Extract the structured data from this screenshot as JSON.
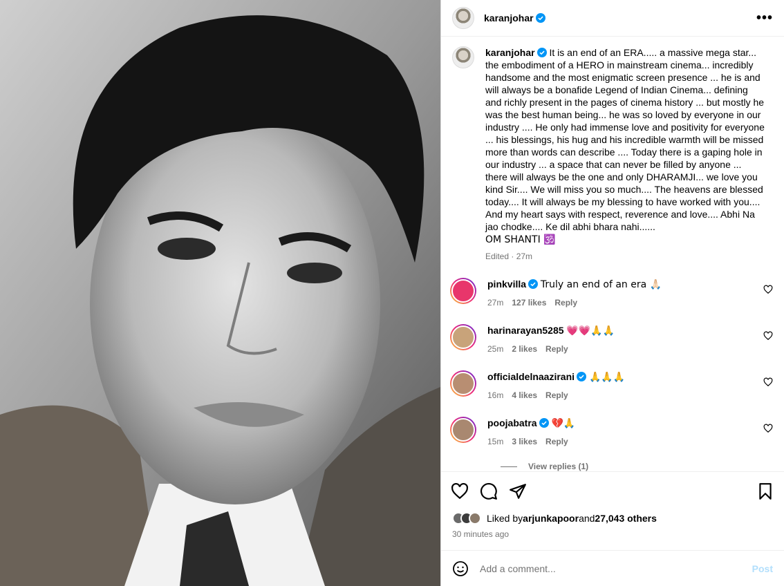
{
  "post": {
    "username": "karanjohar",
    "more_label": "•••",
    "caption": "It is an end of an ERA..... a massive mega star... the embodiment of a HERO in mainstream cinema... incredibly handsome and the most enigmatic screen presence ... he is and will always be a bonafide Legend of Indian Cinema... defining and richly present in the pages of cinema history ... but mostly he was the best human being... he was so loved by everyone in our industry .... He only had immense love and positivity for everyone ... his blessings, his hug and his incredible warmth will be missed more than words can describe .... Today there is a gaping hole in our industry ... a space that can never be filled by anyone ... there will always be the one and only DHARAMJI... we love you kind Sir.... We will miss you so much.... The heavens are blessed today.... It will always be my blessing to have worked with you.... And my heart says with respect, reverence and love.... Abhi Na jao chodke.... Ke dil abhi bhara nahi......",
    "caption_last": "OM SHANTI 🕉️",
    "meta": "Edited · 27m"
  },
  "comments": [
    {
      "user": "pinkvilla",
      "verified": true,
      "text": "Truly an end of an era 🙏🏻",
      "time": "27m",
      "likes": "127 likes",
      "reply": "Reply"
    },
    {
      "user": "harinarayan5285",
      "verified": false,
      "text": "💗💗🙏🙏",
      "time": "25m",
      "likes": "2 likes",
      "reply": "Reply"
    },
    {
      "user": "officialdelnaazirani",
      "verified": true,
      "text": "🙏🙏🙏",
      "time": "16m",
      "likes": "4 likes",
      "reply": "Reply"
    },
    {
      "user": "poojabatra",
      "verified": true,
      "text": "💔🙏",
      "time": "15m",
      "likes": "3 likes",
      "reply": "Reply"
    }
  ],
  "view_replies": "View replies (1)",
  "liked_by": {
    "prefix": "Liked by ",
    "user": "arjunkapoor",
    "and": " and ",
    "others": "27,043 others"
  },
  "time_ago": "30 minutes ago",
  "add_comment": {
    "placeholder": "Add a comment...",
    "post_label": "Post"
  },
  "colors": {
    "verified": "#0095f6",
    "post_disabled": "#b2dffc",
    "muted": "#737373"
  }
}
